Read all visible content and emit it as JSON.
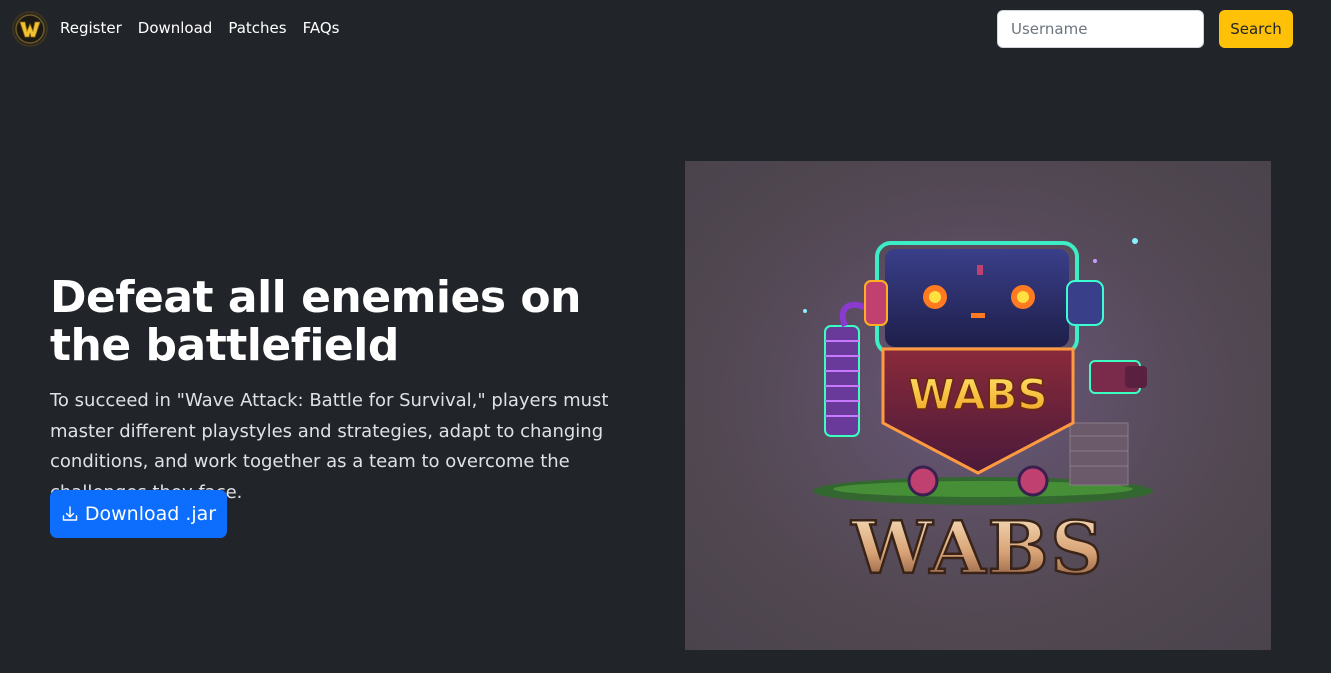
{
  "nav": {
    "links": [
      "Register",
      "Download",
      "Patches",
      "FAQs"
    ]
  },
  "search": {
    "placeholder": "Username",
    "button_label": "Search"
  },
  "hero": {
    "title": "Defeat all enemies on the battlefield",
    "text": "To succeed in \"Wave Attack: Battle for Survival,\" players must master different playstyles and strategies, adapt to changing conditions, and work together as a team to overcome the challenges they face.",
    "download_label": "Download .jar"
  },
  "image": {
    "badge_text": "WABS",
    "logo_text": "WABS"
  },
  "colors": {
    "background": "#212529",
    "primary": "#0d6efd",
    "warning": "#ffc107"
  },
  "icons": {
    "brand": "w-logo-icon",
    "download": "download-icon"
  }
}
